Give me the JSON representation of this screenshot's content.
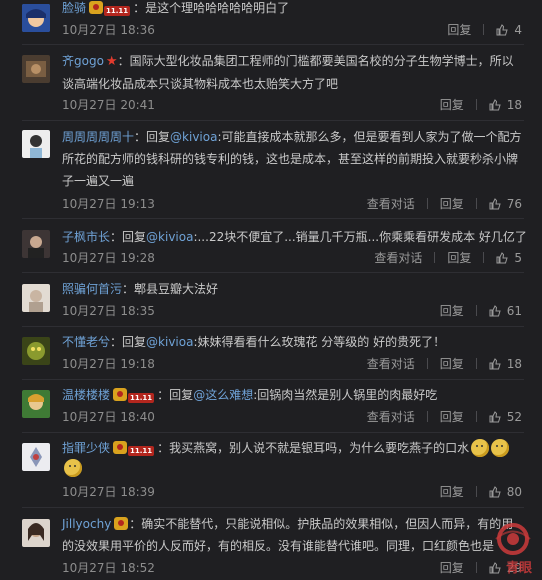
{
  "comments": [
    {
      "name": "脸骑",
      "badge": true,
      "badge11": "11.11",
      "text": "：是这个理哈哈哈哈哈明白了",
      "time": "10月27日 18:36",
      "reply": "回复",
      "likes": "4",
      "avatar_color": "#3a6fc6"
    },
    {
      "name": "齐gogo",
      "star": true,
      "text_line1": "：国际大型化妆品集团工程师的门槛都要美国名校的分子生物学博士，所以",
      "text_line2": "谈高端化妆品成本只谈其物料成本也太贻笑大方了吧",
      "time": "10月27日 20:41",
      "reply": "回复",
      "likes": "18",
      "avatar_color": "#5a4a3e"
    },
    {
      "name": "周周周周周十",
      "prefix": "：回复",
      "mention": "@kivioa",
      "text_line1": ":可能直接成本就那么多，但是要看到人家为了做一个配方",
      "text_line2": "所花的配方师的钱科研的钱专利的钱，这也是成本，甚至这样的前期投入就要秒杀小牌",
      "text_line3": "子一遍又一遍",
      "time": "10月27日 19:13",
      "view": "查看对话",
      "reply": "回复",
      "likes": "76",
      "avatar_color": "#e6e6e6"
    },
    {
      "name": "子枫市长",
      "prefix": "：回复",
      "mention": "@kivioa",
      "text": ":...22块不便宜了...销量几千万瓶...你乘乘看研发成本 好几亿了",
      "time": "10月27日 19:28",
      "view": "查看对话",
      "reply": "回复",
      "likes": "5",
      "avatar_color": "#4a4040"
    },
    {
      "name": "照骗何首污",
      "text": "：郫县豆瓣大法好",
      "time": "10月27日 18:35",
      "reply": "回复",
      "likes": "61",
      "avatar_color": "#d8cfc4"
    },
    {
      "name": "不懂老兮",
      "prefix": "：回复",
      "mention": "@kivioa",
      "text": ":妹妹得看看什么玫瑰花 分等级的 好的贵死了！",
      "time": "10月27日 19:18",
      "view": "查看对话",
      "reply": "回复",
      "likes": "18",
      "avatar_color": "#6a7a2a"
    },
    {
      "name": "温楼楼楼",
      "badge": true,
      "badge11": "11.11",
      "prefix": "：回复",
      "mention": "@这么难想",
      "text": ":回锅肉当然是别人锅里的肉最好吃",
      "time": "10月27日 18:40",
      "view": "查看对话",
      "reply": "回复",
      "likes": "52",
      "avatar_color": "#4f8f3a"
    },
    {
      "name": "指罪少侠",
      "badge": true,
      "badge11": "11.11",
      "text": "：我买燕窝，别人说不就是银耳吗，为什么要吃燕子的口水",
      "time": "10月27日 18:39",
      "reply": "回复",
      "likes": "80",
      "avatar_color": "#e8e8ec"
    },
    {
      "name": "Jillyochy",
      "badge": true,
      "text_line1": "：确实不能替代，只能说相似。护肤品的效果相似，但因人而异，有的用",
      "text_line2": "的没效果用平价的人反而好，有的相反。没有谁能替代谁吧。同理，口红颜色也是",
      "time": "10月27日 18:52",
      "reply": "回复",
      "likes": "29",
      "avatar_color": "#8a7a6a"
    }
  ],
  "watermark": {
    "text": "青眼",
    "icon": "qingyan-eye-logo",
    "color": "#cc3b3b"
  },
  "icons": {
    "like": "thumbs-up-icon"
  }
}
